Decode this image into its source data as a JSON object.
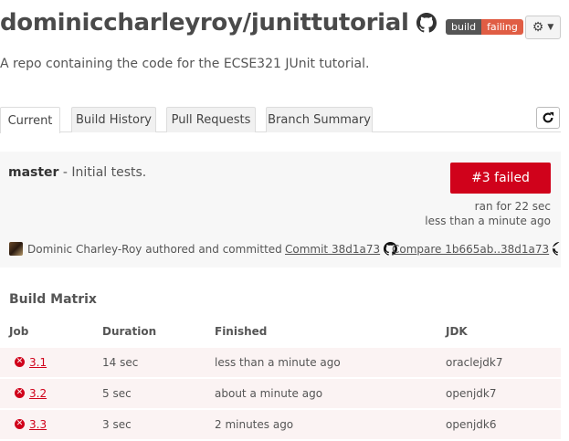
{
  "header": {
    "repo_name": "dominiccharleyroy/junittutorial",
    "badge_left": "build",
    "badge_right": "failing",
    "settings_icon": "gear-icon",
    "description": "A repo containing the code for the ECSE321 JUnit tutorial."
  },
  "tabs": [
    {
      "label": "Current",
      "active": true
    },
    {
      "label": "Build History",
      "active": false
    },
    {
      "label": "Pull Requests",
      "active": false
    },
    {
      "label": "Branch Summary",
      "active": false
    }
  ],
  "summary": {
    "branch": "master",
    "message": " - Initial tests.",
    "status": "#3 failed",
    "status_color": "#d0021b",
    "ran_for": "ran for 22 sec",
    "finished": "less than a minute ago",
    "author": "Dominic Charley-Roy authored and committed",
    "commit": "Commit 38d1a73",
    "compare": "Compare 1b665ab..38d1a73"
  },
  "matrix": {
    "title": "Build Matrix",
    "headers": {
      "job": "Job",
      "duration": "Duration",
      "finished": "Finished",
      "jdk": "JDK"
    },
    "rows": [
      {
        "job": "3.1",
        "duration": "14 sec",
        "finished": "less than a minute ago",
        "jdk": "oraclejdk7"
      },
      {
        "job": "3.2",
        "duration": "5 sec",
        "finished": "about a minute ago",
        "jdk": "openjdk7"
      },
      {
        "job": "3.3",
        "duration": "3 sec",
        "finished": "2 minutes ago",
        "jdk": "openjdk6"
      }
    ]
  }
}
